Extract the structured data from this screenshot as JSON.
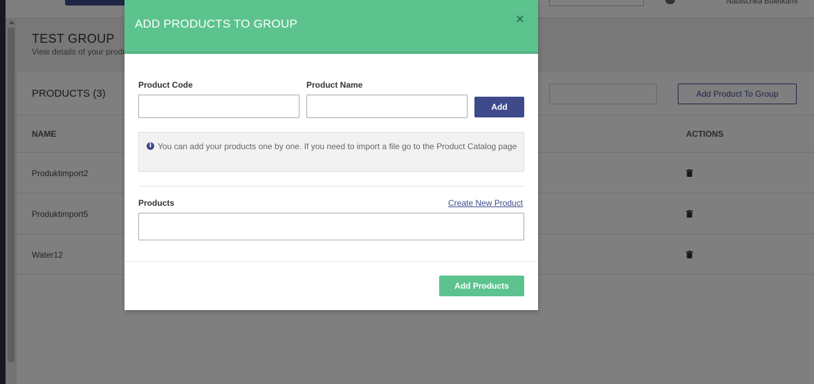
{
  "topbar": {
    "user_name": "Nataschka Buletkami"
  },
  "page": {
    "title": "TEST GROUP",
    "subtitle": "View details of your products group"
  },
  "products_section": {
    "heading": "PRODUCTS (3)",
    "add_to_group_label": "Add Product To Group",
    "columns": {
      "name": "NAME",
      "actions": "ACTIONS"
    },
    "rows": [
      {
        "name": "Produktimport2"
      },
      {
        "name": "Produktimport5"
      },
      {
        "name": "Water12"
      }
    ]
  },
  "modal": {
    "title": "ADD PRODUCTS TO GROUP",
    "close_glyph": "×",
    "product_code_label": "Product Code",
    "product_code_value": "",
    "product_name_label": "Product Name",
    "product_name_value": "",
    "add_label": "Add",
    "info_icon_glyph": "i",
    "info_text": "You can add your products one by one. If you need to import a file go to the Product Catalog page",
    "products_label": "Products",
    "create_new_link": "Create New Product",
    "submit_label": "Add Products"
  },
  "colors": {
    "accent_green": "#5cc38e",
    "primary_indigo": "#3f4a8a"
  }
}
